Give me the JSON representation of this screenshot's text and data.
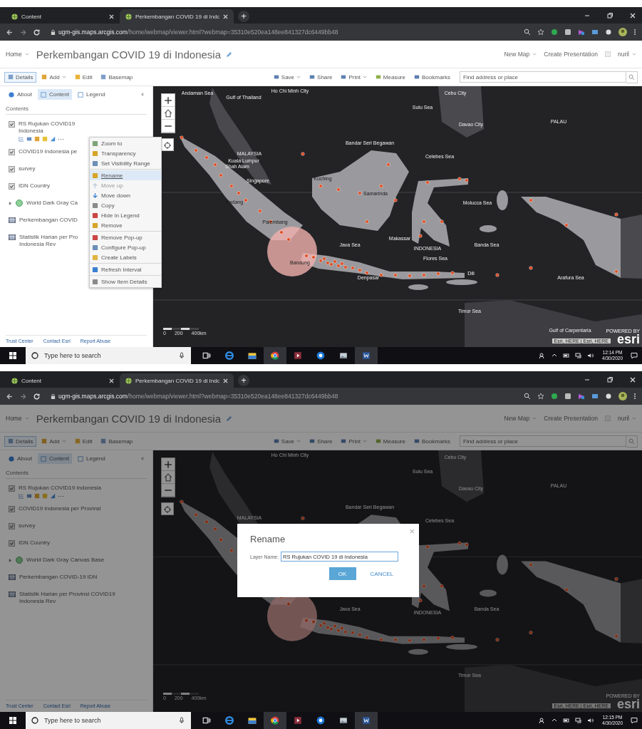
{
  "screens": [
    {
      "browser": {
        "tabs": [
          {
            "label": "Content",
            "selected": false
          },
          {
            "label": "Perkembangan COVID 19 di Indo",
            "selected": true
          }
        ],
        "new_tab": "+",
        "url_host": "ugm-gis.maps.arcgis.com",
        "url_path": "/home/webmap/viewer.html?webmap=35310e520ea148ee841327dc6449bb48"
      },
      "header": {
        "home": "Home",
        "title": "Perkembangan COVID 19 di Indonesia",
        "new_map": "New Map",
        "presentation": "Create Presentation",
        "user": "nuril"
      },
      "toolbar": {
        "left": [
          {
            "label": "Details",
            "selected": true,
            "dropdown": false
          },
          {
            "label": "Add",
            "selected": false,
            "dropdown": true
          },
          {
            "label": "Edit",
            "selected": false,
            "dropdown": false
          },
          {
            "label": "Basemap",
            "selected": false,
            "dropdown": false
          }
        ],
        "right": [
          {
            "label": "Save",
            "dropdown": true
          },
          {
            "label": "Share",
            "dropdown": false
          },
          {
            "label": "Print",
            "dropdown": true
          },
          {
            "label": "Measure",
            "dropdown": false
          },
          {
            "label": "Bookmarks",
            "dropdown": false
          }
        ],
        "search": {
          "placeholder": "Find address or place"
        }
      },
      "panel": {
        "tabs": [
          {
            "label": "About",
            "selected": false
          },
          {
            "label": "Content",
            "selected": true
          },
          {
            "label": "Legend",
            "selected": false
          }
        ],
        "heading": "Contents",
        "more": "···",
        "layers": [
          {
            "kind": "layer",
            "label": "RS Rujukan COVID19 Indonesia",
            "checked": true
          },
          {
            "kind": "layer",
            "label": "COVID19 Indonesia pe",
            "checked": true
          },
          {
            "kind": "layer",
            "label": "survey",
            "checked": true
          },
          {
            "kind": "layer",
            "label": "IDN Country",
            "checked": true
          },
          {
            "kind": "basemap",
            "label": "World Dark Gray Ca"
          },
          {
            "kind": "table",
            "label": "Perkembangan COVID"
          },
          {
            "kind": "table",
            "label": "Statistik Harian per Pro Indonesia Rev"
          }
        ],
        "footer": [
          "Trust Center",
          "Contact Esri",
          "Report Abuse"
        ]
      },
      "map": {
        "labels": [
          "Andaman Sea",
          "Gulf of Thailand",
          "Ho Chi Minh City",
          "Cebu City",
          "Sulu Sea",
          "Davao City",
          "PALAU",
          "MALAYSIA",
          "Kuala Lumpur",
          "Shah Alam",
          "Bandar Seri Begawan",
          "Celebes Sea",
          "Singapore",
          "Kuching",
          "Padang",
          "Samarinda",
          "Molucca Sea",
          "Makassar",
          "Palembang",
          "Java Sea",
          "INDONESIA",
          "Banda Sea",
          "Flores Sea",
          "Bandung",
          "Denpasar",
          "Dili",
          "Arafura Sea",
          "Timor Sea",
          "Gulf of Carpentaria"
        ],
        "scale": [
          "0",
          "200",
          "400km"
        ],
        "attribution": "Esri, HERE | Esri, HERE",
        "logo_caption": "POWERED BY",
        "logo": "esri"
      },
      "context_menu": {
        "groups": [
          [
            {
              "label": "Zoom to",
              "disabled": false,
              "selected": false
            },
            {
              "label": "Transparency",
              "disabled": false,
              "selected": false
            },
            {
              "label": "Set Visibility Range",
              "disabled": false,
              "selected": false
            }
          ],
          [
            {
              "label": "Rename",
              "disabled": false,
              "selected": true
            },
            {
              "label": "Move up",
              "disabled": true,
              "selected": false
            },
            {
              "label": "Move down",
              "disabled": false,
              "selected": false
            },
            {
              "label": "Copy",
              "disabled": false,
              "selected": false
            },
            {
              "label": "Hide in Legend",
              "disabled": false,
              "selected": false
            },
            {
              "label": "Remove",
              "disabled": false,
              "selected": false
            }
          ],
          [
            {
              "label": "Remove Pop-up",
              "disabled": false,
              "selected": false
            },
            {
              "label": "Configure Pop-up",
              "disabled": false,
              "selected": false
            },
            {
              "label": "Create Labels",
              "disabled": false,
              "selected": false
            }
          ],
          [
            {
              "label": "Refresh Interval",
              "disabled": false,
              "selected": false
            }
          ],
          [
            {
              "label": "Show Item Details",
              "disabled": false,
              "selected": false
            }
          ]
        ]
      },
      "taskbar": {
        "search": {
          "placeholder": "Type here to search"
        },
        "time": "12:14 PM",
        "date": "4/30/2020"
      }
    },
    {
      "browser": {
        "tabs": [
          {
            "label": "Content",
            "selected": false
          },
          {
            "label": "Perkembangan COVID 19 di Indo",
            "selected": true
          }
        ],
        "new_tab": "+",
        "url_host": "ugm-gis.maps.arcgis.com",
        "url_path": "/home/webmap/viewer.html?webmap=35310e520ea148ee841327dc6449bb48"
      },
      "header": {
        "home": "Home",
        "title": "Perkembangan COVID 19 di Indonesia",
        "new_map": "New Map",
        "presentation": "Create Presentation",
        "user": "nuril"
      },
      "toolbar": {
        "left": [
          {
            "label": "Details",
            "selected": true,
            "dropdown": false
          },
          {
            "label": "Add",
            "selected": false,
            "dropdown": true
          },
          {
            "label": "Edit",
            "selected": false,
            "dropdown": false
          },
          {
            "label": "Basemap",
            "selected": false,
            "dropdown": false
          }
        ],
        "right": [
          {
            "label": "Save",
            "dropdown": true
          },
          {
            "label": "Share",
            "dropdown": false
          },
          {
            "label": "Print",
            "dropdown": true
          },
          {
            "label": "Measure",
            "dropdown": false
          },
          {
            "label": "Bookmarks",
            "dropdown": false
          }
        ],
        "search": {
          "placeholder": "Find address or place"
        }
      },
      "panel": {
        "tabs": [
          {
            "label": "About",
            "selected": false
          },
          {
            "label": "Content",
            "selected": true
          },
          {
            "label": "Legend",
            "selected": false
          }
        ],
        "heading": "Contents",
        "more": "···",
        "layers": [
          {
            "kind": "layer",
            "label": "RS Rujukan COVID19 Indonesia",
            "checked": true
          },
          {
            "kind": "layer",
            "label": "COVID19 Indonesia per Provinsi",
            "checked": true
          },
          {
            "kind": "layer",
            "label": "survey",
            "checked": true
          },
          {
            "kind": "layer",
            "label": "IDN Country",
            "checked": true
          },
          {
            "kind": "basemap",
            "label": "World Dark Gray Canvas Base"
          },
          {
            "kind": "table",
            "label": "Perkembangan COVID-19 IDN"
          },
          {
            "kind": "table",
            "label": "Statistik Harian per Provinsi COVID19 Indonesia Rev"
          }
        ],
        "footer": [
          "Trust Center",
          "Contact Esri",
          "Report Abuse"
        ]
      },
      "map": {
        "labels": [
          "Ho Chi Minh City",
          "Cebu City",
          "Sulu Sea",
          "Davao City",
          "PALAU",
          "MALAYSIA",
          "Bandar Seri Begawan",
          "Celebes Sea",
          "Java Sea",
          "INDONESIA",
          "Banda Sea",
          "Timor Sea"
        ],
        "scale": [
          "0",
          "200",
          "400km"
        ],
        "attribution": "Esri, HERE | Esri, HERE",
        "logo_caption": "POWERED BY",
        "logo": "esri"
      },
      "dialog": {
        "title": "Rename",
        "close": "×",
        "field_label": "Layer Name:",
        "value": "RS Rujukan COVID 19 di Indonesia",
        "ok": "OK",
        "cancel": "CANCEL"
      },
      "taskbar": {
        "search": {
          "placeholder": "Type here to search"
        },
        "time": "12:15 PM",
        "date": "4/30/2020"
      }
    }
  ]
}
